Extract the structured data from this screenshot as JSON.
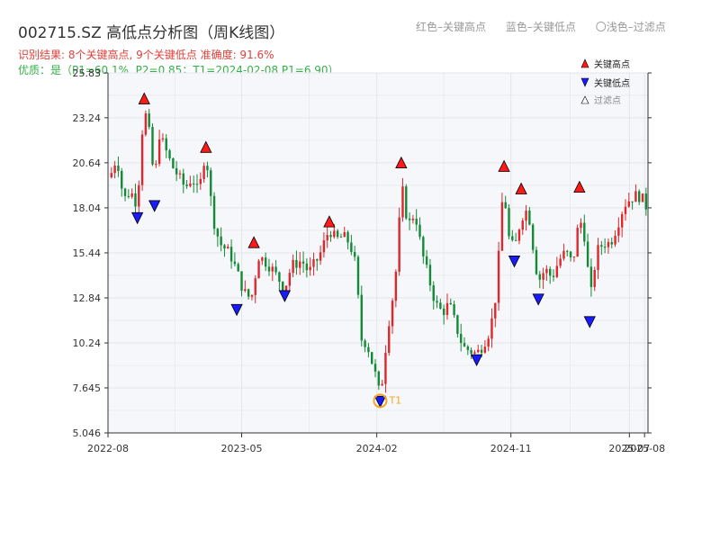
{
  "header": {
    "title": "002715.SZ 高低点分析图（周K线图）",
    "result_text": "识别结果: 8个关键高点, 9个关键低点   准确度: 91.6%",
    "quality_text": "优质：是（P1=60.1%, P2=0.85；T1=2024-02-08 P1=6.90）",
    "legend_high": "红色–关键高点",
    "legend_low": "蓝色–关键低点",
    "legend_filtered": "〇浅色–过滤点"
  },
  "colors": {
    "up": "#e0262b",
    "down": "#138a36",
    "high_marker": "#ff1a1a",
    "low_marker": "#1a1aff",
    "t1_marker": "#f5a623",
    "plot_bg": "#f5f7fa",
    "grid": "#e3e6ea"
  },
  "chart_data": {
    "type": "candlestick",
    "y_ticks": [
      "25.83",
      "23.24",
      "20.64",
      "18.04",
      "15.44",
      "12.84",
      "10.24",
      "7.645",
      "5.046"
    ],
    "ylim": [
      5.046,
      25.83
    ],
    "x_ticks": [
      "2022-08",
      "2023-05",
      "2024-02",
      "2024-11",
      "2025-07",
      "2025-08"
    ],
    "legend": {
      "high": "关键高点",
      "low": "关键低点",
      "filtered": "过滤点"
    },
    "annotation": "T1",
    "grid": true,
    "series_anchors": [
      [
        "2022-08-05",
        19.8
      ],
      [
        "2022-08-19",
        21.0
      ],
      [
        "2022-09-02",
        18.5
      ],
      [
        "2022-09-16",
        19.0
      ],
      [
        "2022-09-30",
        18.2
      ],
      [
        "2022-10-07",
        21.5
      ],
      [
        "2022-10-14",
        23.8
      ],
      [
        "2022-10-28",
        21.8
      ],
      [
        "2022-11-04",
        18.8
      ],
      [
        "2022-11-11",
        22.5
      ],
      [
        "2022-11-25",
        21.5
      ],
      [
        "2022-12-09",
        20.5
      ],
      [
        "2023-01-06",
        19.2
      ],
      [
        "2023-01-20",
        19.8
      ],
      [
        "2023-02-03",
        18.8
      ],
      [
        "2023-02-10",
        20.5
      ],
      [
        "2023-02-17",
        21.2
      ],
      [
        "2023-03-03",
        17.5
      ],
      [
        "2023-03-17",
        16.0
      ],
      [
        "2023-04-07",
        15.4
      ],
      [
        "2023-04-21",
        14.4
      ],
      [
        "2023-05-05",
        13.2
      ],
      [
        "2023-05-19",
        12.8
      ],
      [
        "2023-05-26",
        13.3
      ],
      [
        "2023-06-02",
        15.3
      ],
      [
        "2023-06-16",
        15.0
      ],
      [
        "2023-06-30",
        14.6
      ],
      [
        "2023-07-14",
        14.0
      ],
      [
        "2023-07-28",
        13.4
      ],
      [
        "2023-08-11",
        14.7
      ],
      [
        "2023-09-01",
        15.0
      ],
      [
        "2023-09-15",
        14.3
      ],
      [
        "2023-10-06",
        15.2
      ],
      [
        "2023-10-20",
        16.3
      ],
      [
        "2023-10-27",
        16.8
      ],
      [
        "2023-11-10",
        16.2
      ],
      [
        "2023-11-24",
        16.4
      ],
      [
        "2023-12-08",
        16.0
      ],
      [
        "2023-12-22",
        14.5
      ],
      [
        "2023-12-29",
        10.5
      ],
      [
        "2024-01-12",
        10.2
      ],
      [
        "2024-02-02",
        8.0
      ],
      [
        "2024-02-08",
        7.0
      ],
      [
        "2024-02-23",
        11.0
      ],
      [
        "2024-03-08",
        13.5
      ],
      [
        "2024-03-15",
        15.5
      ],
      [
        "2024-03-22",
        19.5
      ],
      [
        "2024-04-05",
        17.0
      ],
      [
        "2024-04-19",
        17.8
      ],
      [
        "2024-05-03",
        15.5
      ],
      [
        "2024-05-17",
        14.0
      ],
      [
        "2024-05-31",
        12.5
      ],
      [
        "2024-06-14",
        12.0
      ],
      [
        "2024-06-28",
        12.5
      ],
      [
        "2024-07-12",
        11.2
      ],
      [
        "2024-07-26",
        10.0
      ],
      [
        "2024-08-09",
        9.8
      ],
      [
        "2024-08-23",
        9.6
      ],
      [
        "2024-09-06",
        10.2
      ],
      [
        "2024-09-20",
        11.0
      ],
      [
        "2024-10-04",
        13.5
      ],
      [
        "2024-10-11",
        17.5
      ],
      [
        "2024-10-18",
        19.4
      ],
      [
        "2024-10-25",
        16.5
      ],
      [
        "2024-11-08",
        15.6
      ],
      [
        "2024-11-22",
        17.5
      ],
      [
        "2024-12-06",
        18.0
      ],
      [
        "2024-12-20",
        15.0
      ],
      [
        "2024-12-27",
        13.8
      ],
      [
        "2025-01-10",
        14.5
      ],
      [
        "2025-01-24",
        14.0
      ],
      [
        "2025-02-07",
        15.0
      ],
      [
        "2025-02-21",
        15.5
      ],
      [
        "2025-03-07",
        14.8
      ],
      [
        "2025-03-21",
        17.5
      ],
      [
        "2025-04-04",
        16.0
      ],
      [
        "2025-04-11",
        12.5
      ],
      [
        "2025-04-25",
        15.5
      ],
      [
        "2025-05-09",
        16.0
      ],
      [
        "2025-05-23",
        16.0
      ],
      [
        "2025-06-06",
        17.0
      ],
      [
        "2025-06-20",
        18.2
      ],
      [
        "2025-07-04",
        18.6
      ],
      [
        "2025-07-18",
        18.8
      ],
      [
        "2025-08-01",
        18.4
      ],
      [
        "2025-08-08",
        17.8
      ]
    ],
    "key_highs": [
      {
        "date": "2022-10-14",
        "value": 24.3
      },
      {
        "date": "2023-02-17",
        "value": 21.5
      },
      {
        "date": "2023-05-26",
        "value": 16.0
      },
      {
        "date": "2023-10-27",
        "value": 17.2
      },
      {
        "date": "2024-03-22",
        "value": 20.6
      },
      {
        "date": "2024-10-18",
        "value": 20.4
      },
      {
        "date": "2024-11-22",
        "value": 19.1
      },
      {
        "date": "2025-03-21",
        "value": 19.2
      }
    ],
    "key_lows": [
      {
        "date": "2022-09-30",
        "value": 17.5
      },
      {
        "date": "2022-11-04",
        "value": 18.2
      },
      {
        "date": "2023-04-21",
        "value": 12.2
      },
      {
        "date": "2023-07-28",
        "value": 13.0
      },
      {
        "date": "2024-02-08",
        "value": 6.9
      },
      {
        "date": "2024-08-23",
        "value": 9.3
      },
      {
        "date": "2024-11-08",
        "value": 15.0
      },
      {
        "date": "2024-12-27",
        "value": 12.8
      },
      {
        "date": "2025-04-11",
        "value": 11.5
      }
    ],
    "t1": {
      "date": "2024-02-08",
      "value": 6.9
    }
  }
}
